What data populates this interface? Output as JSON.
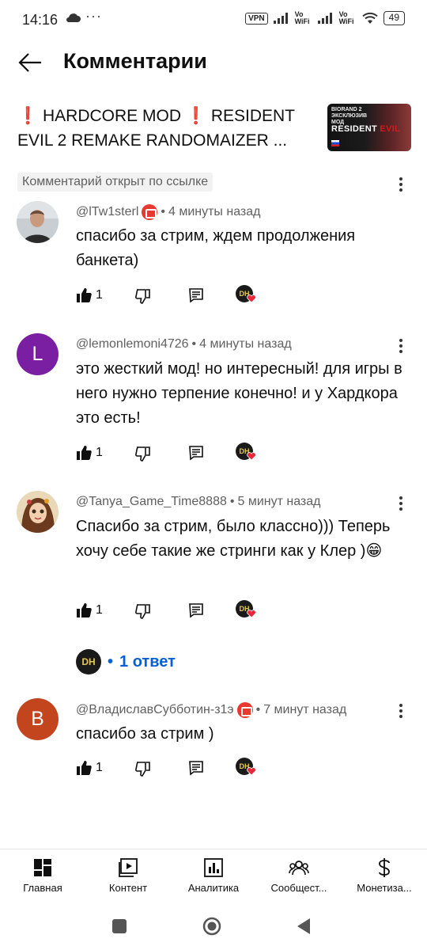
{
  "status_bar": {
    "time": "14:16",
    "dots": "···",
    "vpn": "VPN",
    "vowifi_1": "Vo WiFi",
    "vowifi_2": "Vo WiFi",
    "battery": "49"
  },
  "header": {
    "title": "Комментарии"
  },
  "video": {
    "title_parts": [
      "❗",
      " HARDCORE MOD ",
      "❗",
      " RESIDENT EVIL 2 REMAKE RANDOMAIZER ..."
    ],
    "thumb_top_text": "BIORAND 2 ЭКСКЛЮЗИВ МОД",
    "thumb_brand_1": "RESIDENT ",
    "thumb_brand_2": "EVIL"
  },
  "linked_badge": "Комментарий открыт по ссылке",
  "comments": [
    {
      "author": "@lTw1sterl",
      "time": "4 минуты назад",
      "text": "спасибо за стрим, ждем продолжения банкета)",
      "likes": "1",
      "avatar_letter": "",
      "member_badge": true
    },
    {
      "author": "@lemonlemoni4726",
      "time": "4 минуты назад",
      "text": "это жесткий мод! но интересный! для игры в него нужно терпение конечно! и у Хардкора это есть!",
      "likes": "1",
      "avatar_letter": "L",
      "member_badge": false
    },
    {
      "author": "@Tanya_Game_Time8888",
      "time": "5 минут назад",
      "text": "Спасибо за стрим, было классно))) Теперь хочу себе такие же стринги как у Клер )😁",
      "likes": "1",
      "avatar_letter": "",
      "member_badge": false
    },
    {
      "author": "@ВладиславСубботин-з1э",
      "time": "7 минут назад",
      "text": "спасибо за стрим )",
      "likes": "1",
      "avatar_letter": "B",
      "member_badge": true
    }
  ],
  "replies_link": "1 ответ",
  "creator_initials": "DH",
  "bottom_nav": [
    "Главная",
    "Контент",
    "Аналитика",
    "Сообщест...",
    "Монетиза..."
  ],
  "colors": {
    "accent_blue": "#065fd4",
    "avatar_L": "#7b1fa2",
    "avatar_B": "#c2451e",
    "member_red": "#e8382f"
  }
}
